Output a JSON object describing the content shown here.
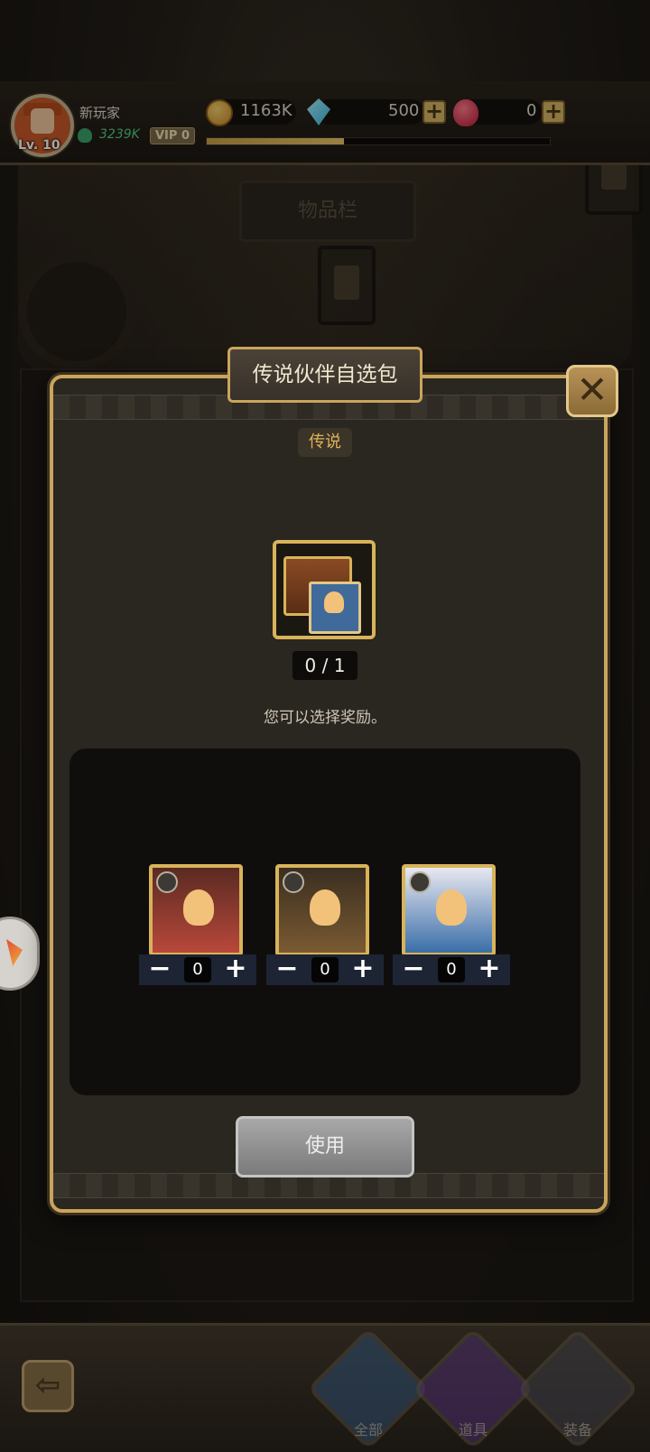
{
  "header": {
    "player_name": "新玩家",
    "level": "Lv. 10",
    "power": "3239K",
    "vip": "VIP 0",
    "xp_progress": 0.4,
    "gold": "1163K",
    "diamonds": "500",
    "rubies": "0"
  },
  "background": {
    "panel_title": "物品栏"
  },
  "modal": {
    "title": "传说伙伴自选包",
    "rarity": "传说",
    "counter": "0 / 1",
    "hint": "您可以选择奖励。",
    "use_label": "使用",
    "close_glyph": "✕"
  },
  "options": [
    {
      "qty": "0",
      "minus": "−",
      "plus": "+",
      "art_color": "#b8483a"
    },
    {
      "qty": "0",
      "minus": "−",
      "plus": "+",
      "art_color": "#7a5a32"
    },
    {
      "qty": "0",
      "minus": "−",
      "plus": "+",
      "art_color": "#3a6ea8"
    }
  ],
  "nav": {
    "back_glyph": "⇦",
    "tabs": [
      "全部",
      "道具",
      "装备"
    ]
  },
  "colors": {
    "gold_frame": "#c9a55c",
    "use_button": "#8f8f8f",
    "stepper_bg": "#1d2433"
  }
}
